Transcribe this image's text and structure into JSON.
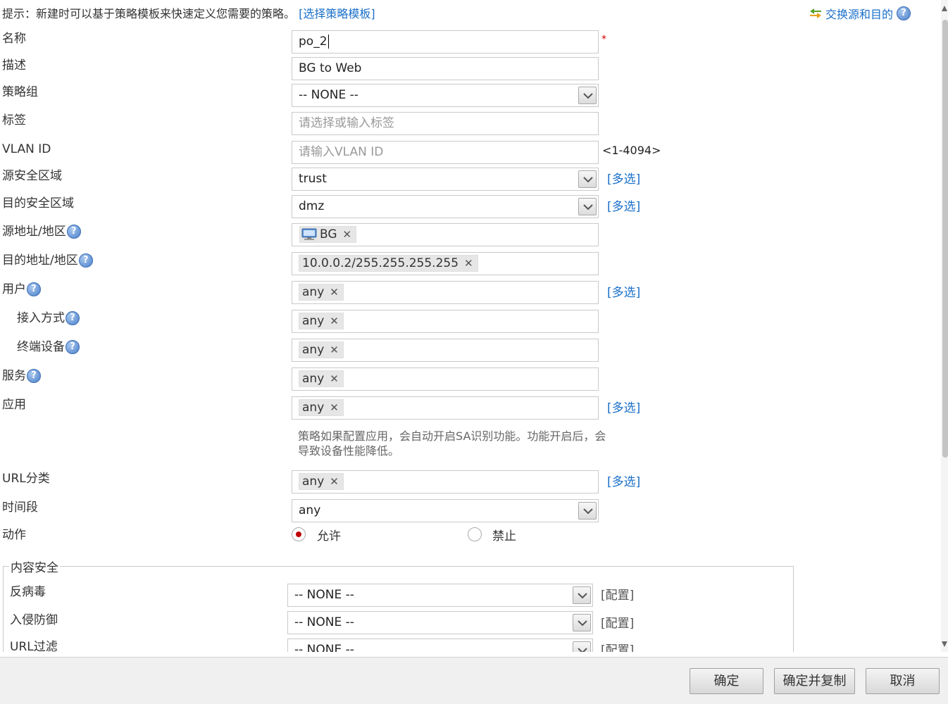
{
  "hint": {
    "prefix": "提示：新建时可以基于策略模板来快速定义您需要的策略。",
    "link": "[选择策略模板]"
  },
  "swap_link": "交换源和目的",
  "help_glyph": "?",
  "required_mark": "*",
  "labels": {
    "name": "名称",
    "desc": "描述",
    "policy_group": "策略组",
    "tag": "标签",
    "vlan": "VLAN ID",
    "src_zone": "源安全区域",
    "dst_zone": "目的安全区域",
    "src_addr": "源地址/地区",
    "dst_addr": "目的地址/地区",
    "user": "用户",
    "access": "接入方式",
    "terminal": "终端设备",
    "service": "服务",
    "app": "应用",
    "url_cat": "URL分类",
    "time": "时间段",
    "action": "动作"
  },
  "values": {
    "name": "po_2",
    "desc": "BG to Web",
    "policy_group": "-- NONE --",
    "tag_placeholder": "请选择或输入标签",
    "vlan_placeholder": "请输入VLAN ID",
    "vlan_range": "<1-4094>",
    "src_zone": "trust",
    "dst_zone": "dmz",
    "src_addr_tag": "BG",
    "dst_addr_tag": "10.0.0.2/255.255.255.255",
    "user_tag": "any",
    "access_tag": "any",
    "terminal_tag": "any",
    "service_tag": "any",
    "app_tag": "any",
    "url_cat_tag": "any",
    "time": "any"
  },
  "remove_glyph": "✕",
  "multi_select": "[多选]",
  "app_note": "策略如果配置应用，会自动开启SA识别功能。功能开启后，会导致设备性能降低。",
  "action": {
    "permit": "允许",
    "deny": "禁止",
    "selected": "permit"
  },
  "content_security": {
    "legend": "内容安全",
    "rows": [
      {
        "label": "反病毒",
        "value": "-- NONE --",
        "config": "[配置]"
      },
      {
        "label": "入侵防御",
        "value": "-- NONE --",
        "config": "[配置]"
      },
      {
        "label": "URL过滤",
        "value": "-- NONE --",
        "config": "[配置]"
      }
    ]
  },
  "buttons": {
    "ok": "确定",
    "ok_copy": "确定并复制",
    "cancel": "取消"
  }
}
